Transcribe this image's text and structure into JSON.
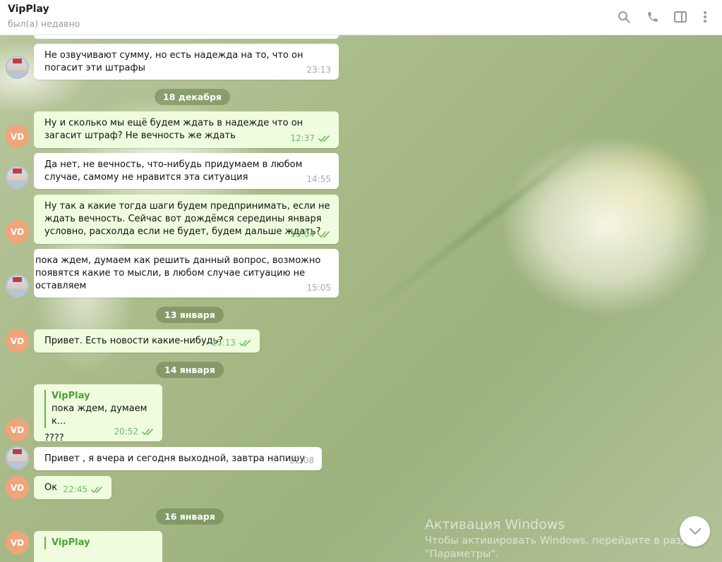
{
  "header": {
    "title": "VipPlay",
    "status": "был(а) недавно",
    "icons": [
      "search-icon",
      "phone-icon",
      "sidebar-icon",
      "more-icon"
    ]
  },
  "avatars": {
    "vd_initials": "VD"
  },
  "messages": [
    {
      "text": "Не озвучивают  сумму, но есть надежда на то, что он погасит эти штрафы",
      "time": "23:13"
    },
    {
      "text": "Ну и сколько мы ещё будем ждать в надежде что он загасит штраф? Не вечность же ждать",
      "time": "12:37"
    },
    {
      "text": "Да нет, не вечность,  что-нибудь  придумаем в любом  случае, самому не нравится эта ситуация",
      "time": "14:55"
    },
    {
      "text": "Ну так а какие тогда шаги будем предпринимать, если не ждать вечность. Сейчас вот дождёмся середины января условно, расхолда если не будет, будем дальше ждать?",
      "time": "15:04"
    },
    {
      "text": "пока ждем, думаем как решить данный вопрос, возможно появятся какие то мысли, в любом случае ситуацию не оставляем",
      "time": "15:05"
    },
    {
      "text": "Привет. Есть новости какие-нибудь?",
      "time": "15:13"
    },
    {
      "reply_name": "VipPlay",
      "reply_text": "пока ждем, думаем к...",
      "text": "????",
      "time": "20:52"
    },
    {
      "text": "Привет  , я вчера и сегодня  выходной,  завтра напишу",
      "time": "22:08"
    },
    {
      "text": "Ок",
      "time": "22:45"
    },
    {
      "reply_name": "VipPlay"
    }
  ],
  "dates": [
    "18 декабря",
    "13 января",
    "14 января",
    "16 января"
  ],
  "watermark": {
    "line1": "Активация Windows",
    "line2": "Чтобы активировать Windows, перейдите в раздел",
    "line3": "\"Параметры\"."
  },
  "colors": {
    "incoming_bubble": "#ffffff",
    "outgoing_bubble": "#effdde",
    "read_check": "#6dbc5f",
    "avatar_vd": "#f0a47a",
    "date_pill": "#7d9862"
  }
}
